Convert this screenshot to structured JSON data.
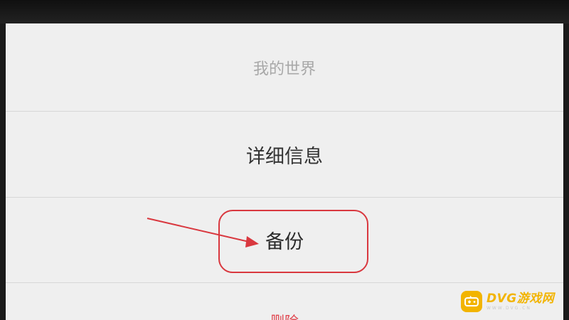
{
  "menu": {
    "title": "我的世界",
    "items": [
      {
        "label": "详细信息"
      },
      {
        "label": "备份"
      },
      {
        "label": "删除"
      }
    ]
  },
  "watermark": {
    "brand": "DVG游戏网",
    "url": "WWW.DVG.CN"
  },
  "colors": {
    "sheet_background": "#efefef",
    "annotation_red": "#d9383f",
    "delete_red": "#e0464f",
    "watermark_yellow": "#f2b400"
  },
  "annotations": {
    "arrow_icon": "arrow-pointer-icon",
    "highlight": "rounded-rectangle-outline"
  }
}
